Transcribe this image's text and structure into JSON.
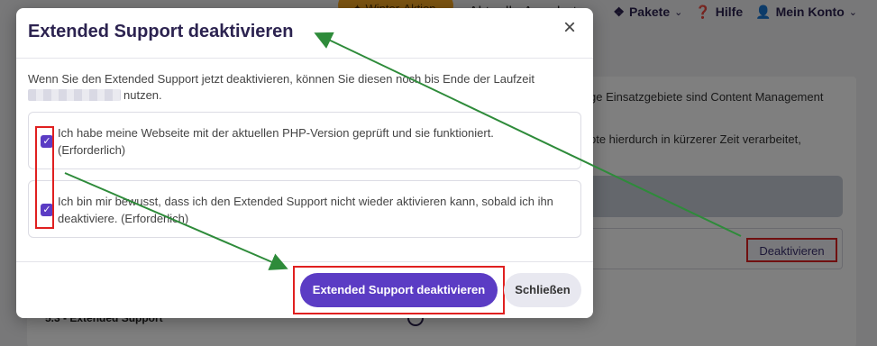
{
  "topnav": {
    "promo_label": "✦ Winter-Aktion",
    "partial_label": "Aktuelle Angebote",
    "items": [
      {
        "label": "Pakete",
        "icon": "boxes-icon",
        "has_chevron": true
      },
      {
        "label": "Hilfe",
        "icon": "question-icon",
        "has_chevron": false
      },
      {
        "label": "Mein Konto",
        "icon": "user-icon",
        "has_chevron": true
      }
    ]
  },
  "background": {
    "text_line1": "ge Einsatzgebiete sind Content Management",
    "text_line2": "pte hierdurch in kürzerer Zeit verarbeitet,",
    "deactivate_button": "Deaktivieren",
    "section_title": "5.3 - Extended Support"
  },
  "modal": {
    "title": "Extended Support deaktivieren",
    "intro_text": "Wenn Sie den Extended Support jetzt deaktivieren, können Sie diesen noch bis Ende der Laufzeit",
    "intro_suffix": "nutzen.",
    "checkbox1_label": "Ich habe meine Webseite mit der aktuellen PHP-Version geprüft und sie funktioniert. (Erforderlich)",
    "checkbox2_label": "Ich bin mir bewusst, dass ich den Extended Support nicht wieder aktivieren kann, sobald ich ihn deaktiviere. (Erforderlich)",
    "checkbox1_checked": true,
    "checkbox2_checked": true,
    "confirm_button": "Extended Support deaktivieren",
    "close_button": "Schließen",
    "close_icon": "×"
  },
  "colors": {
    "accent": "#5b3cc4",
    "title": "#2c2350",
    "highlight": "#e02020",
    "arrow": "#2e8b3a"
  }
}
